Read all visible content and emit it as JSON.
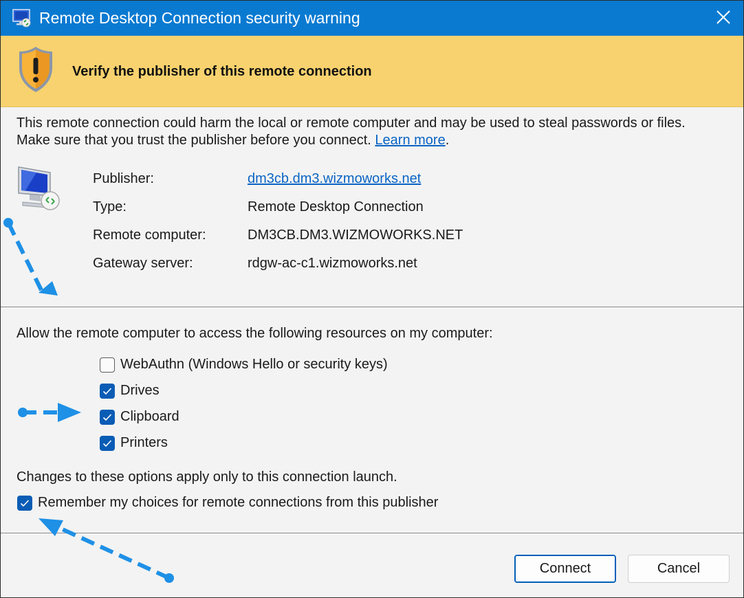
{
  "window": {
    "title": "Remote Desktop Connection security warning",
    "app_icon": "remote-desktop-icon",
    "close_icon": "close-icon"
  },
  "banner": {
    "icon": "warning-shield-icon",
    "heading": "Verify the publisher of this remote connection",
    "background": "#f7d26e"
  },
  "description": {
    "text": "This remote connection could harm the local or remote computer and may be used to steal passwords or files. Make sure that you trust the publisher before you connect.",
    "link": "Learn more",
    "suffix": "."
  },
  "details": {
    "icon": "remote-monitor-icon",
    "rows": [
      {
        "label": "Publisher:",
        "value": "dm3cb.dm3.wizmoworks.net",
        "is_link": true
      },
      {
        "label": "Type:",
        "value": "Remote Desktop Connection"
      },
      {
        "label": "Remote computer:",
        "value": "DM3CB.DM3.WIZMOWORKS.NET"
      },
      {
        "label": "Gateway server:",
        "value": "rdgw-ac-c1.wizmoworks.net"
      }
    ]
  },
  "resources": {
    "label": "Allow the remote computer to access the following resources on my computer:",
    "options": [
      {
        "label": "WebAuthn (Windows Hello or security keys)",
        "checked": false
      },
      {
        "label": "Drives",
        "checked": true
      },
      {
        "label": "Clipboard",
        "checked": true
      },
      {
        "label": "Printers",
        "checked": true
      }
    ]
  },
  "note": "Changes to these options apply only to this connection launch.",
  "remember": {
    "label": "Remember my choices for remote connections from this publisher",
    "checked": true
  },
  "buttons": {
    "connect": "Connect",
    "cancel": "Cancel"
  },
  "colors": {
    "titlebar": "#0a7ad1",
    "accent": "#0a5cb5",
    "annotation_arrow": "#1e90e6"
  }
}
